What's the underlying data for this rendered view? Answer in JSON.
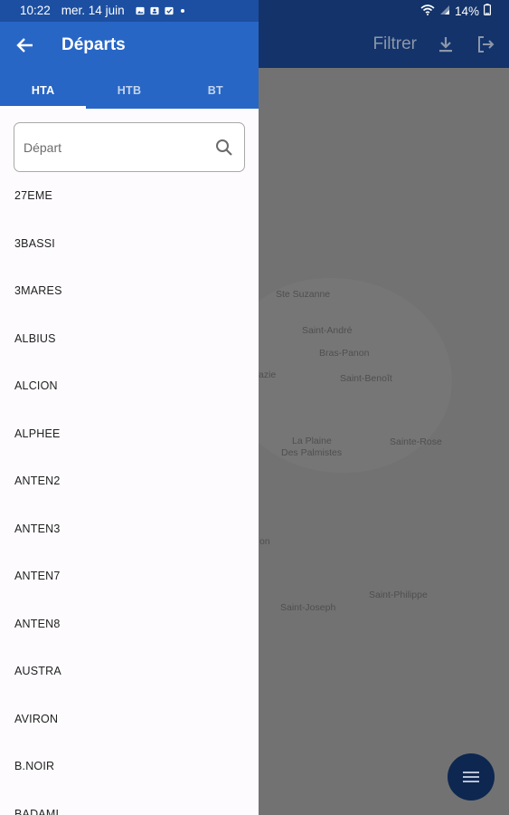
{
  "status_bar": {
    "time": "10:22",
    "date": "mer. 14 juin",
    "battery": "14%"
  },
  "background_app": {
    "filter_label": "Filtrer",
    "map_labels": [
      "Ste Suzanne",
      "Saint-André",
      "Bras-Panon",
      "Saint-Benoît",
      "azie",
      "La Plaine",
      "Des Palmistes",
      "Sainte-Rose",
      "on",
      "Saint-Philippe",
      "Saint-Joseph"
    ]
  },
  "drawer": {
    "title": "Départs",
    "tabs": [
      {
        "label": "HTA",
        "active": true
      },
      {
        "label": "HTB",
        "active": false
      },
      {
        "label": "BT",
        "active": false
      }
    ],
    "search": {
      "placeholder": "Départ",
      "value": ""
    },
    "items": [
      "27EME",
      "3BASSI",
      "3MARES",
      "ALBIUS",
      "ALCION",
      "ALPHEE",
      "ANTEN2",
      "ANTEN3",
      "ANTEN7",
      "ANTEN8",
      "AUSTRA",
      "AVIRON",
      "B.NOIR",
      "BADAMI"
    ]
  },
  "colors": {
    "drawer_header": "#2766c5",
    "app_bar": "#13336a",
    "fab": "#0d2750"
  }
}
